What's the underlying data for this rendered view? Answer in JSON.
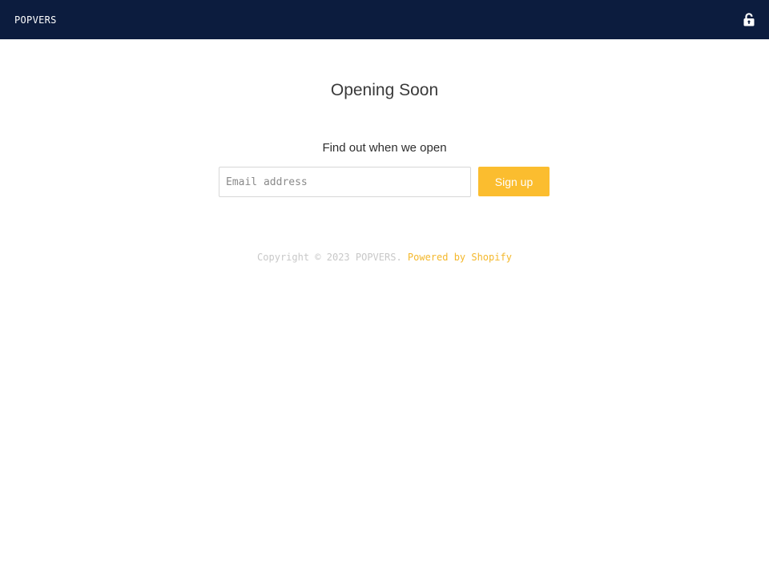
{
  "header": {
    "brand": "POPVERS",
    "lock_icon": "lock-icon"
  },
  "main": {
    "title": "Opening Soon",
    "subtitle": "Find out when we open",
    "email_placeholder": "Email address",
    "signup_label": "Sign up"
  },
  "footer": {
    "copyright": "Copyright © 2023 POPVERS.",
    "powered_by": "Powered by Shopify"
  },
  "colors": {
    "header_bg": "#0c1c3e",
    "accent": "#fbbd2f"
  }
}
